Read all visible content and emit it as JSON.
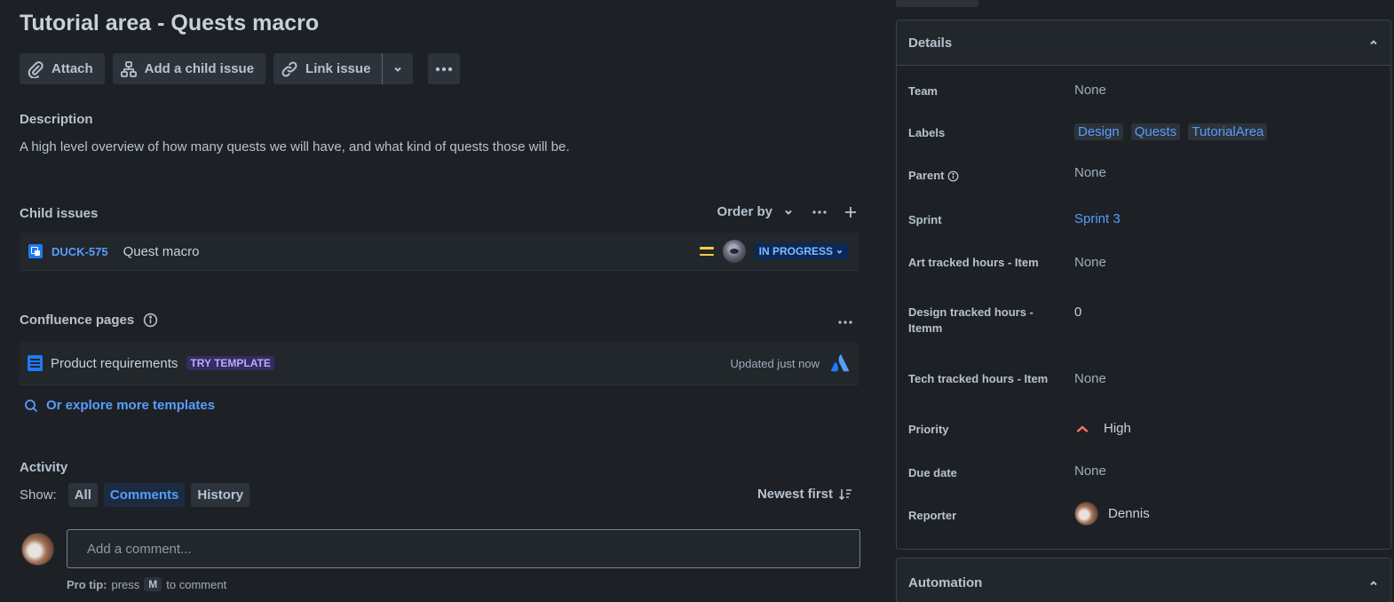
{
  "issue": {
    "title": "Tutorial area - Quests macro"
  },
  "toolbar": {
    "attach_label": "Attach",
    "add_child_label": "Add a child issue",
    "link_issue_label": "Link issue"
  },
  "description": {
    "heading": "Description",
    "text": "A high level overview of how many quests we will have, and what kind of quests those will be."
  },
  "child_issues": {
    "heading": "Child issues",
    "order_by_label": "Order by",
    "items": [
      {
        "key": "DUCK-575",
        "title": "Quest macro",
        "status": "IN PROGRESS",
        "priority": "medium"
      }
    ]
  },
  "confluence": {
    "heading": "Confluence pages",
    "items": [
      {
        "title": "Product requirements",
        "badge": "TRY TEMPLATE",
        "updated": "Updated just now"
      }
    ],
    "explore_label": "Or explore more templates"
  },
  "activity": {
    "heading": "Activity",
    "show_label": "Show:",
    "filters": [
      "All",
      "Comments",
      "History"
    ],
    "active_filter": "Comments",
    "sort_label": "Newest first",
    "comment_placeholder": "Add a comment...",
    "protip_prefix": "Pro tip:",
    "protip_press": "press",
    "protip_key": "M",
    "protip_suffix": "to comment"
  },
  "details": {
    "heading": "Details",
    "team": {
      "label": "Team",
      "value": "None"
    },
    "labels": {
      "label": "Labels",
      "values": [
        "Design",
        "Quests",
        "TutorialArea"
      ]
    },
    "parent": {
      "label": "Parent",
      "value": "None"
    },
    "sprint": {
      "label": "Sprint",
      "value": "Sprint 3"
    },
    "art_hours": {
      "label": "Art tracked hours - Item",
      "value": "None"
    },
    "design_hours": {
      "label": "Design tracked hours - Itemm",
      "value": "0"
    },
    "tech_hours": {
      "label": "Tech tracked hours - Item",
      "value": "None"
    },
    "priority": {
      "label": "Priority",
      "value": "High"
    },
    "due_date": {
      "label": "Due date",
      "value": "None"
    },
    "reporter": {
      "label": "Reporter",
      "value": "Dennis"
    }
  },
  "automation": {
    "heading": "Automation"
  },
  "colors": {
    "background": "#1d2125",
    "link": "#579dff",
    "status_bg": "#092957",
    "priority_medium": "#f5cd47",
    "priority_high": "#f87462"
  }
}
